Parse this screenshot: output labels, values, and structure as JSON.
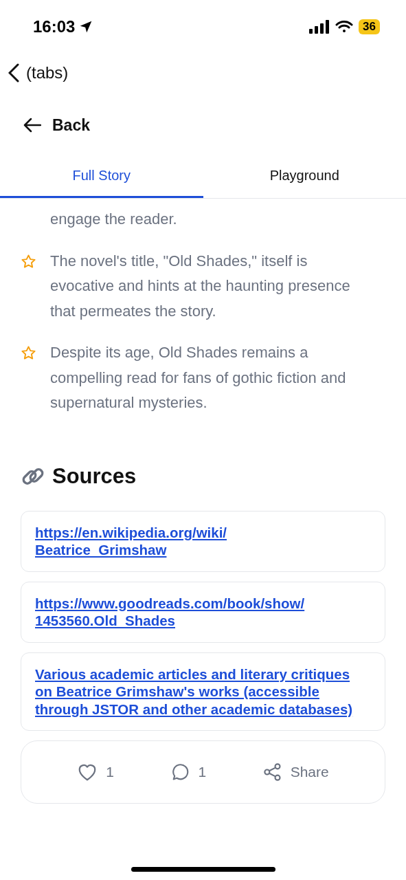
{
  "status_bar": {
    "time": "16:03",
    "battery": "36"
  },
  "nav": {
    "back_label": "(tabs)"
  },
  "header": {
    "back_button": "Back"
  },
  "tabs": [
    {
      "label": "Full Story",
      "selected": true
    },
    {
      "label": "Playground",
      "selected": false
    }
  ],
  "highlights": [
    {
      "kind": "continuation",
      "text": "engage the reader."
    },
    {
      "kind": "bullet",
      "text": "The novel's title, \"Old Shades,\" itself is evocative and hints at the haunting presence that permeates the story."
    },
    {
      "kind": "bullet",
      "text": "Despite its age, Old Shades remains a compelling read for fans of gothic fiction and supernatural mysteries."
    }
  ],
  "sources": {
    "title": "Sources",
    "items": [
      {
        "lines": [
          "https://en.wikipedia.org/wiki/",
          "Beatrice_Grimshaw"
        ]
      },
      {
        "lines": [
          "https://www.goodreads.com/book/show/",
          "1453560.Old_Shades"
        ]
      },
      {
        "lines": [
          "Various academic articles and literary critiques",
          "on Beatrice Grimshaw's works (accessible",
          "through JSTOR and other academic databases)"
        ]
      }
    ]
  },
  "actions": {
    "likes": "1",
    "comments": "1",
    "share": "Share"
  }
}
